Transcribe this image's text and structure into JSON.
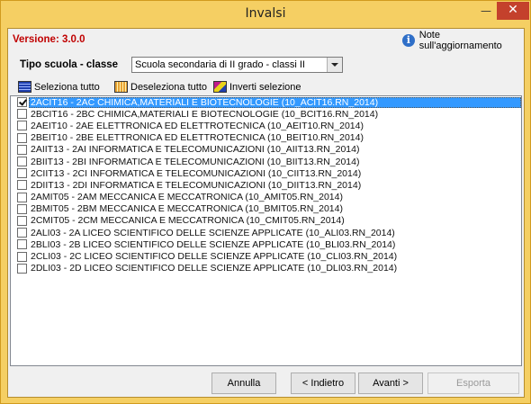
{
  "window": {
    "title": "Invalsi",
    "minimize_glyph": "—",
    "close_glyph": "✕"
  },
  "header": {
    "version": "Versione: 3.0.0",
    "notes_label": "Note sull'aggiornamento",
    "notes_icon": "info-icon"
  },
  "school_type": {
    "label": "Tipo scuola - classe",
    "selected": "Scuola secondaria di II grado - classi II"
  },
  "toolbar": {
    "select_all": "Seleziona tutto",
    "deselect_all": "Deseleziona tutto",
    "invert_selection": "Inverti selezione"
  },
  "classes": [
    {
      "label": "2ACIT16 - 2AC CHIMICA,MATERIALI E BIOTECNOLOGIE (10_ACIT16.RN_2014)",
      "checked": true,
      "selected": true
    },
    {
      "label": "2BCIT16 - 2BC CHIMICA,MATERIALI E BIOTECNOLOGIE (10_BCIT16.RN_2014)",
      "checked": false,
      "selected": false
    },
    {
      "label": "2AEIT10 - 2AE ELETTRONICA ED ELETTROTECNICA  (10_AEIT10.RN_2014)",
      "checked": false,
      "selected": false
    },
    {
      "label": "2BEIT10 - 2BE ELETTRONICA ED ELETTROTECNICA  (10_BEIT10.RN_2014)",
      "checked": false,
      "selected": false
    },
    {
      "label": "2AIIT13 - 2AI INFORMATICA E TELECOMUNICAZIONI (10_AIIT13.RN_2014)",
      "checked": false,
      "selected": false
    },
    {
      "label": "2BIIT13 - 2BI INFORMATICA E TELECOMUNICAZIONI (10_BIIT13.RN_2014)",
      "checked": false,
      "selected": false
    },
    {
      "label": "2CIIT13 - 2CI INFORMATICA E TELECOMUNICAZIONI (10_CIIT13.RN_2014)",
      "checked": false,
      "selected": false
    },
    {
      "label": "2DIIT13 - 2DI INFORMATICA E TELECOMUNICAZIONI (10_DIIT13.RN_2014)",
      "checked": false,
      "selected": false
    },
    {
      "label": "2AMIT05 - 2AM MECCANICA E MECCATRONICA (10_AMIT05.RN_2014)",
      "checked": false,
      "selected": false
    },
    {
      "label": "2BMIT05 - 2BM MECCANICA E MECCATRONICA (10_BMIT05.RN_2014)",
      "checked": false,
      "selected": false
    },
    {
      "label": "2CMIT05 - 2CM MECCANICA E MECCATRONICA (10_CMIT05.RN_2014)",
      "checked": false,
      "selected": false
    },
    {
      "label": "2ALI03 - 2A LICEO SCIENTIFICO DELLE SCIENZE APPLICATE (10_ALI03.RN_2014)",
      "checked": false,
      "selected": false
    },
    {
      "label": "2BLI03 - 2B LICEO SCIENTIFICO DELLE SCIENZE APPLICATE (10_BLI03.RN_2014)",
      "checked": false,
      "selected": false
    },
    {
      "label": "2CLI03 - 2C LICEO SCIENTIFICO DELLE SCIENZE APPLICATE (10_CLI03.RN_2014)",
      "checked": false,
      "selected": false
    },
    {
      "label": "2DLI03 - 2D LICEO SCIENTIFICO DELLE SCIENZE APPLICATE (10_DLI03.RN_2014)",
      "checked": false,
      "selected": false
    }
  ],
  "buttons": {
    "cancel": "Annulla",
    "back": "< Indietro",
    "next": "Avanti >",
    "export": "Esporta"
  },
  "colors": {
    "frame": "#f5cf63",
    "close": "#c4412c",
    "version_text": "#c00000",
    "selection": "#3399ff"
  }
}
